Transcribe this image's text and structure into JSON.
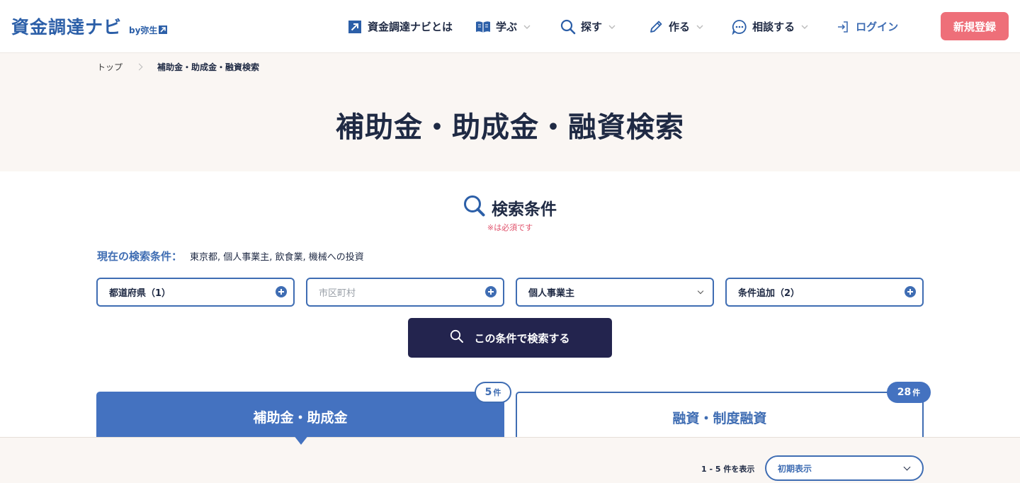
{
  "header": {
    "logo_text": "資金調達ナビ",
    "logo_by": "by弥生",
    "nav": [
      {
        "label": "資金調達ナビとは",
        "icon": "external-square-arrow-icon"
      },
      {
        "label": "学ぶ",
        "icon": "open-book-icon"
      },
      {
        "label": "探す",
        "icon": "search-icon"
      },
      {
        "label": "作る",
        "icon": "pencil-icon"
      },
      {
        "label": "相談する",
        "icon": "chat-bubble-icon"
      }
    ],
    "login_label": "ログイン",
    "signup_label": "新規登録",
    "colors": {
      "brand": "#2c5fa8",
      "signup": "#ee6f79"
    }
  },
  "breadcrumb": {
    "top": "トップ",
    "current": "補助金・助成金・融資検索"
  },
  "page_title": "補助金・助成金・融資検索",
  "search": {
    "title": "検索条件",
    "required_note": "※は必須です",
    "current_label": "現在の検索条件：",
    "current_value": "東京都, 個人事業主, 飲食業, 機械への投資",
    "fields": {
      "prefecture": "都道府県（1）",
      "city_placeholder": "市区町村",
      "business_type": "個人事業主",
      "add_condition": "条件追加（2）"
    },
    "submit_label": "この条件で検索する"
  },
  "tabs": [
    {
      "label": "補助金・助成金",
      "count": "5",
      "unit": "件"
    },
    {
      "label": "融資・制度融資",
      "count": "28",
      "unit": "件"
    }
  ],
  "results": {
    "count_text": "1 - 5 件を表示",
    "sort_value": "初期表示"
  }
}
